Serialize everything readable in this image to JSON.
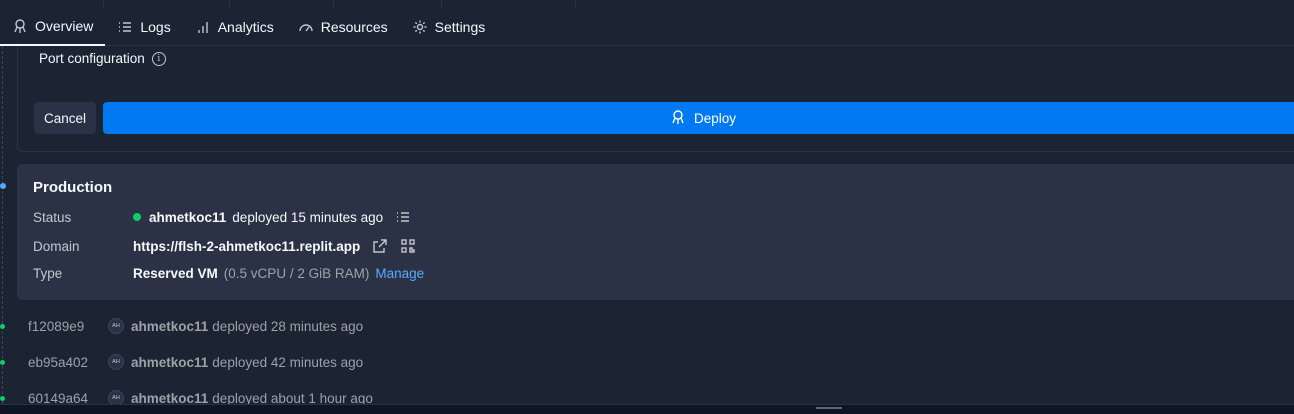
{
  "tabs": [
    {
      "label": "Overview",
      "icon": "deploy-rocket-icon",
      "active": true
    },
    {
      "label": "Logs",
      "icon": "list-icon"
    },
    {
      "label": "Analytics",
      "icon": "bar-chart-icon"
    },
    {
      "label": "Resources",
      "icon": "gauge-icon"
    },
    {
      "label": "Settings",
      "icon": "gear-icon"
    }
  ],
  "config": {
    "port_label": "Port configuration",
    "info_glyph": "i",
    "cancel_label": "Cancel",
    "deploy_label": "Deploy"
  },
  "production": {
    "title": "Production",
    "status_key": "Status",
    "status_user": "ahmetkoc11",
    "status_text": "deployed 15 minutes ago",
    "status_color": "#0cce6b",
    "domain_key": "Domain",
    "domain_value": "https://flsh-2-ahmetkoc11.replit.app",
    "type_key": "Type",
    "type_value": "Reserved VM",
    "type_detail": "(0.5 vCPU / 2 GiB RAM)",
    "manage_label": "Manage"
  },
  "history": [
    {
      "hash": "f12089e9",
      "avatar": "AH",
      "user": "ahmetkoc11",
      "text": "deployed 28 minutes ago"
    },
    {
      "hash": "eb95a402",
      "avatar": "AH",
      "user": "ahmetkoc11",
      "text": "deployed 42 minutes ago"
    },
    {
      "hash": "60149a64",
      "avatar": "AH",
      "user": "ahmetkoc11",
      "text": "deployed about 1 hour ago"
    }
  ],
  "colors": {
    "background": "#1c2333",
    "card": "#2b3245",
    "accent": "#0079f2",
    "link": "#57abff",
    "success": "#0cce6b"
  }
}
